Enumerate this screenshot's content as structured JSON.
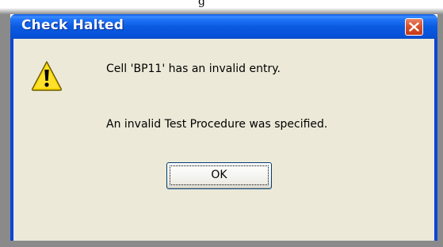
{
  "dialog": {
    "title": "Check Halted",
    "close_icon": "close-icon",
    "warning_icon": "warning-icon",
    "message_line1": "Cell 'BP11' has an invalid entry.",
    "message_line2": "An invalid Test Procedure was specified.",
    "ok_label": "OK"
  },
  "background": {
    "partial_text": "g"
  },
  "colors": {
    "titlebar": "#0b5be0",
    "client": "#ece9d8",
    "close_button": "#d9522b",
    "warning": "#ffd800"
  }
}
